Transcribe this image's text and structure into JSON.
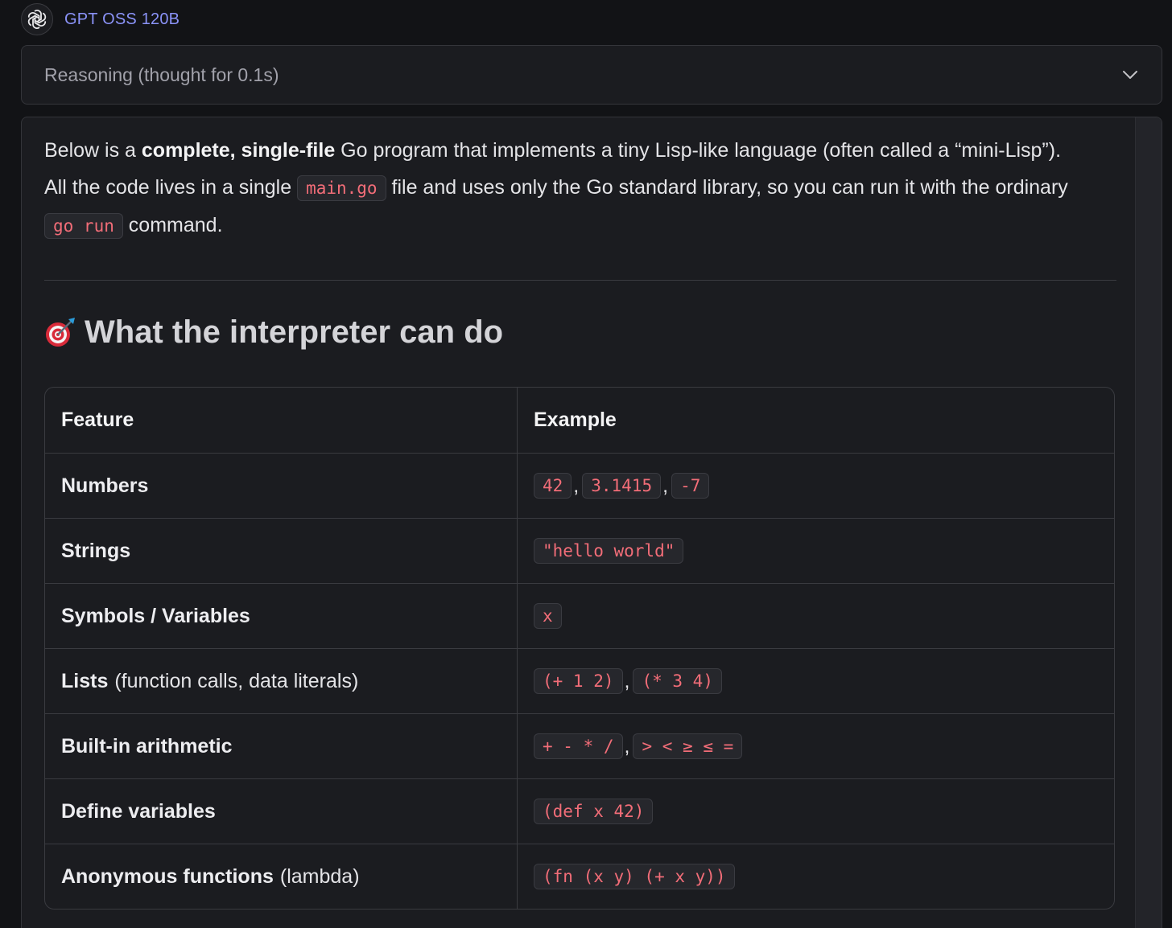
{
  "header": {
    "model_name": "GPT OSS 120B",
    "avatar_icon": "openai-logo-icon"
  },
  "reasoning": {
    "label": "Reasoning (thought for 0.1s)",
    "toggle_icon": "chevron-down-icon"
  },
  "intro": {
    "p1_before": "Below is a ",
    "p1_bold": "complete, single-file",
    "p1_after": " Go program that implements a tiny Lisp-like language (often called a “mini-Lisp”).",
    "p2_before": "All the code lives in a single ",
    "p2_code1": "main.go",
    "p2_mid": " file and uses only the Go standard library, so you can run it with the ordinary ",
    "p2_code2": "go run",
    "p2_after": " command."
  },
  "section": {
    "icon": "target-dart-icon",
    "title": "What the interpreter can do"
  },
  "table": {
    "headers": [
      "Feature",
      "Example"
    ],
    "rows": [
      {
        "feature": "Numbers",
        "note": "",
        "examples": [
          "42",
          "3.1415",
          "-7"
        ]
      },
      {
        "feature": "Strings",
        "note": "",
        "examples": [
          "\"hello world\""
        ]
      },
      {
        "feature": "Symbols / Variables",
        "note": "",
        "examples": [
          "x"
        ]
      },
      {
        "feature": "Lists",
        "note": "(function calls, data literals)",
        "examples": [
          "(+ 1 2)",
          "(* 3 4)"
        ]
      },
      {
        "feature": "Built-in arithmetic",
        "note": "",
        "examples": [
          "+ - * /",
          "> < ≥ ≤ ="
        ]
      },
      {
        "feature": "Define variables",
        "note": "",
        "examples": [
          "(def x 42)"
        ]
      },
      {
        "feature": "Anonymous functions",
        "note": "(lambda)",
        "examples": [
          "(fn (x y) (+ x y))"
        ]
      }
    ]
  },
  "colors": {
    "background": "#121316",
    "card": "#1b1c20",
    "accent_model": "#8b93f8",
    "code_text": "#f26d78"
  }
}
